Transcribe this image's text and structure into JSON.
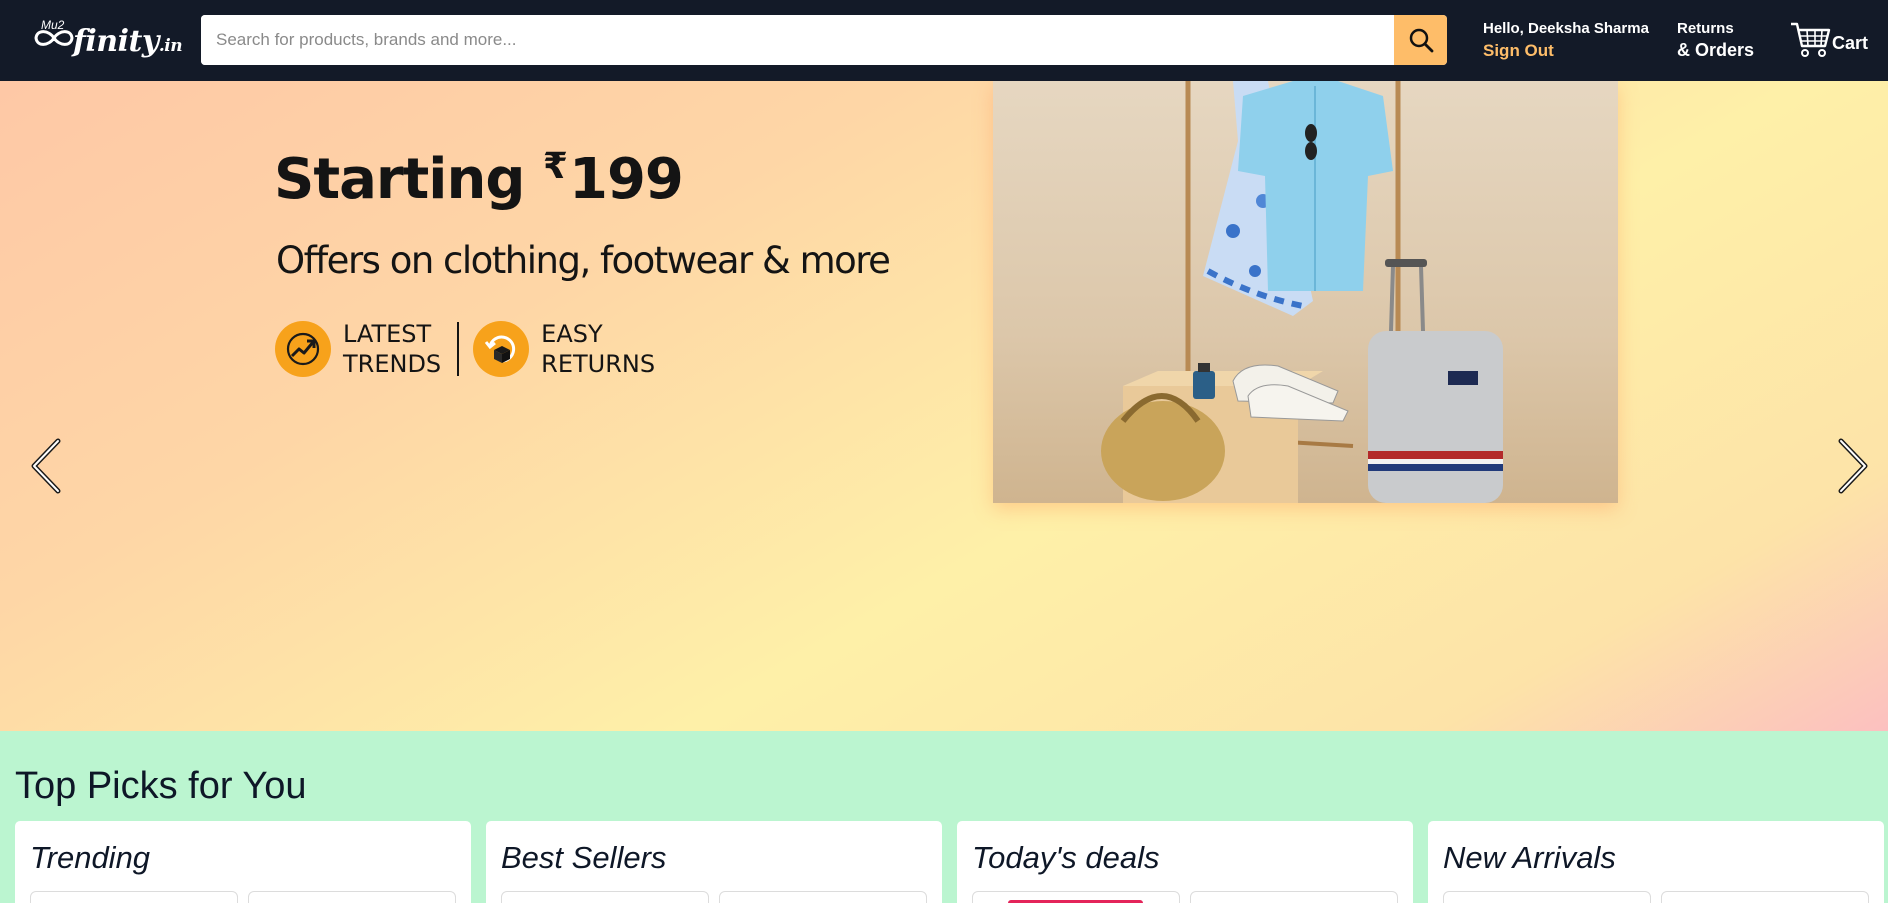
{
  "header": {
    "logo": {
      "sup": "Mu2",
      "word": "finity",
      "suffix": ".in"
    },
    "search": {
      "placeholder": "Search for products, brands and more..."
    },
    "account": {
      "greeting": "Hello, Deeksha Sharma",
      "action": "Sign Out"
    },
    "orders": {
      "line1": "Returns",
      "line2": "& Orders"
    },
    "cart": {
      "label": "Cart"
    }
  },
  "colors": {
    "header_bg": "#131a28",
    "accent": "#febd69",
    "picks_bg": "#bbf5d0",
    "badge": "#f7a21b"
  },
  "hero": {
    "title_prefix": "Starting ",
    "currency": "₹",
    "price": "199",
    "subtitle": "Offers on clothing, footwear & more",
    "badges": [
      {
        "icon": "trend-icon",
        "line1": "LATEST",
        "line2": "TRENDS"
      },
      {
        "icon": "return-box-icon",
        "line1": "EASY",
        "line2": "RETURNS"
      }
    ]
  },
  "top_picks": {
    "title": "Top Picks for You",
    "cards": [
      {
        "title": "Trending"
      },
      {
        "title": "Best Sellers"
      },
      {
        "title": "Today's deals"
      },
      {
        "title": "New Arrivals"
      }
    ]
  }
}
